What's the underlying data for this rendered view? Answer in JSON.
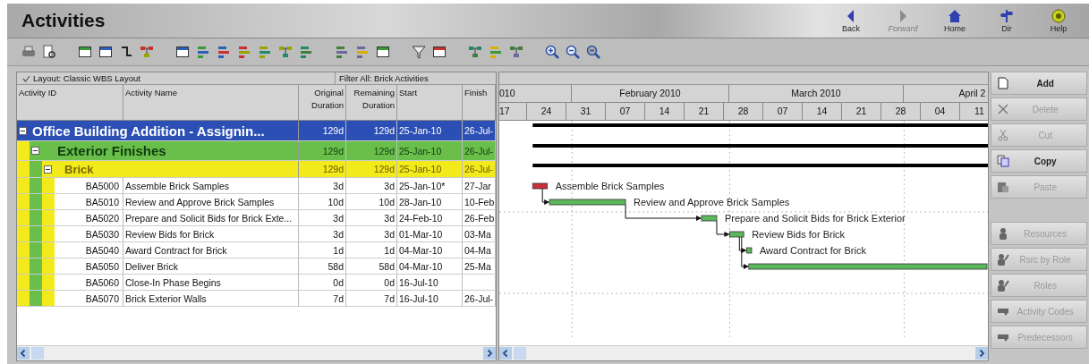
{
  "window": {
    "title": "Activities"
  },
  "nav": [
    {
      "label": "Back",
      "disabled": false
    },
    {
      "label": "Forward",
      "disabled": true
    },
    {
      "label": "Home",
      "disabled": false
    },
    {
      "label": "Dir",
      "disabled": false
    },
    {
      "label": "Help",
      "disabled": false
    }
  ],
  "table": {
    "layout": "Layout: Classic WBS Layout",
    "filter": "Filter All: Brick Activities",
    "columns": [
      "Activity ID",
      "Activity Name",
      "Original Duration",
      "Remaining Duration",
      "Start",
      "Finish"
    ],
    "rows": [
      {
        "kind": "wbs",
        "name": "Office Building Addition - Assignin...",
        "color": "#2b4fb5",
        "expanded": true,
        "original_duration": "129d",
        "remaining_duration": "129d",
        "start": "25-Jan-10",
        "finish": "26-Jul-",
        "children": [
          {
            "kind": "wbs",
            "name": "Exterior Finishes",
            "color": "#6abf4b",
            "expanded": true,
            "original_duration": "129d",
            "remaining_duration": "129d",
            "start": "25-Jan-10",
            "finish": "26-Jul-",
            "children": [
              {
                "kind": "wbs",
                "name": "Brick",
                "color": "#f2ea1a",
                "expanded": true,
                "original_duration": "129d",
                "remaining_duration": "129d",
                "start": "25-Jan-10",
                "finish": "26-Jul-",
                "children": [
                  {
                    "kind": "activity",
                    "id": "BA5000",
                    "name": "Assemble Brick Samples",
                    "original_duration": "3d",
                    "remaining_duration": "3d",
                    "start": "25-Jan-10*",
                    "finish": "27-Jar"
                  },
                  {
                    "kind": "activity",
                    "id": "BA5010",
                    "name": "Review and Approve Brick Samples",
                    "original_duration": "10d",
                    "remaining_duration": "10d",
                    "start": "28-Jan-10",
                    "finish": "10-Feb"
                  },
                  {
                    "kind": "activity",
                    "id": "BA5020",
                    "name": "Prepare and Solicit Bids for Brick Exte...",
                    "original_duration": "3d",
                    "remaining_duration": "3d",
                    "start": "24-Feb-10",
                    "finish": "26-Feb"
                  },
                  {
                    "kind": "activity",
                    "id": "BA5030",
                    "name": "Review Bids for Brick",
                    "original_duration": "3d",
                    "remaining_duration": "3d",
                    "start": "01-Mar-10",
                    "finish": "03-Ma"
                  },
                  {
                    "kind": "activity",
                    "id": "BA5040",
                    "name": "Award Contract for Brick",
                    "original_duration": "1d",
                    "remaining_duration": "1d",
                    "start": "04-Mar-10",
                    "finish": "04-Ma"
                  },
                  {
                    "kind": "activity",
                    "id": "BA5050",
                    "name": "Deliver Brick",
                    "original_duration": "58d",
                    "remaining_duration": "58d",
                    "start": "04-Mar-10",
                    "finish": "25-Ma"
                  },
                  {
                    "kind": "activity",
                    "id": "BA5060",
                    "name": "Close-In Phase Begins",
                    "original_duration": "0d",
                    "remaining_duration": "0d",
                    "start": "16-Jul-10"
                  },
                  {
                    "kind": "activity",
                    "id": "BA5070",
                    "name": "Brick Exterior Walls",
                    "original_duration": "7d",
                    "remaining_duration": "7d",
                    "start": "16-Jul-10",
                    "finish": "26-Jul-"
                  }
                ]
              }
            ]
          }
        ]
      }
    ]
  },
  "gantt": {
    "months": [
      "010",
      "February 2010",
      "March 2010",
      "April 2"
    ],
    "weeks": [
      "17",
      "24",
      "31",
      "07",
      "14",
      "21",
      "28",
      "07",
      "14",
      "21",
      "28",
      "04",
      "11"
    ],
    "bars": [
      {
        "kind": "summary"
      },
      {
        "kind": "summary"
      },
      {
        "kind": "summary"
      },
      {
        "kind": "activity",
        "critical": true,
        "label": "Assemble Brick Samples"
      },
      {
        "kind": "activity",
        "critical": false,
        "label": "Review and Approve Brick Samples"
      },
      {
        "kind": "activity",
        "critical": false,
        "label": "Prepare and Solicit Bids for Brick Exterior"
      },
      {
        "kind": "activity",
        "critical": false,
        "label": "Review Bids for Brick"
      },
      {
        "kind": "activity",
        "critical": false,
        "label": "Award Contract for Brick"
      },
      {
        "kind": "activity",
        "critical": false
      }
    ]
  },
  "actions": [
    {
      "kind": "button",
      "label": "Add",
      "disabled": false
    },
    {
      "kind": "button",
      "label": "Delete",
      "disabled": true
    },
    {
      "kind": "button",
      "label": "Cut",
      "disabled": true
    },
    {
      "kind": "button",
      "label": "Copy",
      "disabled": false
    },
    {
      "kind": "button",
      "label": "Paste",
      "disabled": true
    },
    {
      "kind": "gap"
    },
    {
      "kind": "button",
      "label": "Resources",
      "disabled": true
    },
    {
      "kind": "button",
      "label": "Rsrc by Role",
      "disabled": true
    },
    {
      "kind": "button",
      "label": "Roles",
      "disabled": true
    },
    {
      "kind": "button",
      "label": "Activity Codes",
      "disabled": true
    },
    {
      "kind": "button",
      "label": "Predecessors",
      "disabled": true
    }
  ]
}
